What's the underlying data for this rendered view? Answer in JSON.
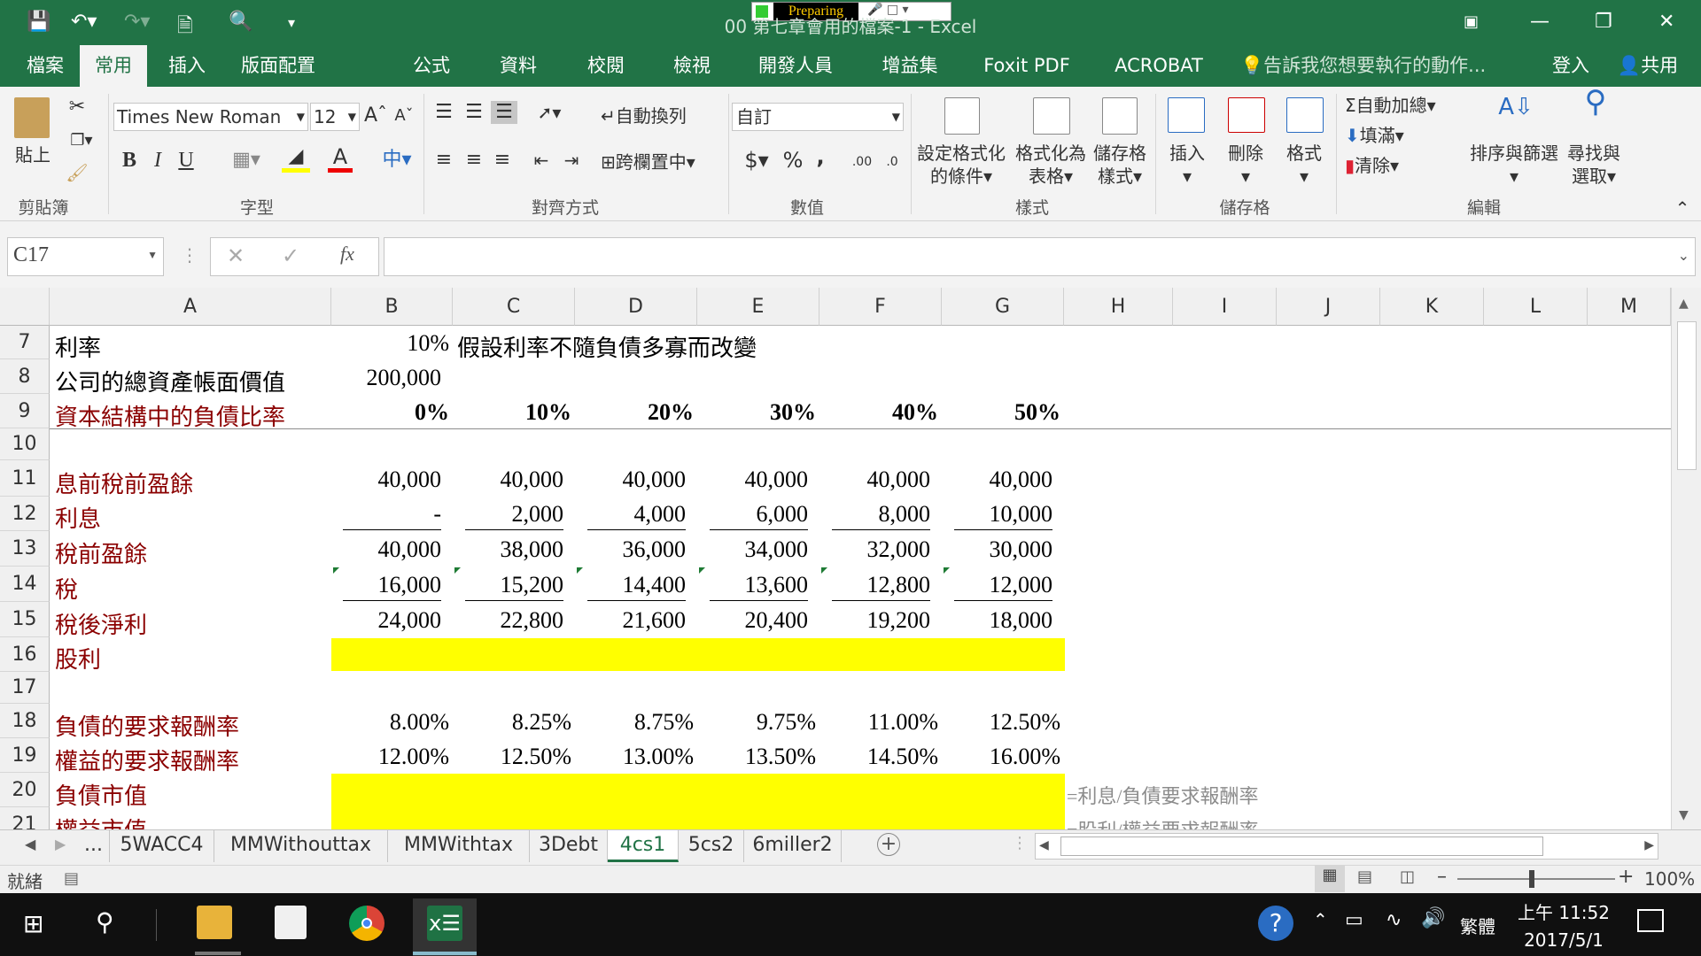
{
  "window": {
    "title": "00 第七章會用的檔案-1 - Excel",
    "preparing": "Preparing"
  },
  "ribbon_tabs": [
    "檔案",
    "常用",
    "插入",
    "版面配置",
    "公式",
    "資料",
    "校閱",
    "檢視",
    "開發人員",
    "增益集",
    "Foxit PDF",
    "ACROBAT"
  ],
  "tell_me": "告訴我您想要執行的動作...",
  "login": "登入",
  "share": "共用",
  "ribbon": {
    "paste": "貼上",
    "clipboard": "剪貼簿",
    "font_name": "Times New Roman",
    "font_size": "12",
    "font_group": "字型",
    "bold": "B",
    "italic": "I",
    "underline": "U",
    "font_color": "A",
    "cjk": "中",
    "wrap_text": "自動換列",
    "merge_center": "跨欄置中",
    "alignment_group": "對齊方式",
    "number_format": "自訂",
    "currency": "$",
    "percent": "%",
    "comma": ",",
    "inc_decimal": ".00",
    "dec_decimal": ".0",
    "number_group": "數值",
    "cond_format_1": "設定格式化",
    "cond_format_2": "的條件",
    "format_table_1": "格式化為",
    "format_table_2": "表格",
    "cell_styles_1": "儲存格",
    "cell_styles_2": "樣式",
    "styles_group": "樣式",
    "insert": "插入",
    "delete": "刪除",
    "format": "格式",
    "cells_group": "儲存格",
    "autosum": "自動加總",
    "fill": "填滿",
    "clear": "清除",
    "sort_filter": "排序與篩選",
    "find_select_1": "尋找與",
    "find_select_2": "選取",
    "editing_group": "編輯"
  },
  "formula_bar": {
    "name_box": "C17",
    "fx": "fx",
    "formula": ""
  },
  "columns": [
    "A",
    "B",
    "C",
    "D",
    "E",
    "F",
    "G",
    "H",
    "I",
    "J",
    "K",
    "L",
    "M"
  ],
  "rows": {
    "r7": {
      "num": "7",
      "label": "利率",
      "b": "10%",
      "note": "假設利率不隨負債多寡而改變"
    },
    "r8": {
      "num": "8",
      "label": "公司的總資產帳面價值",
      "b": "200,000"
    },
    "r9": {
      "num": "9",
      "label": "資本結構中的負債比率",
      "values": [
        "0%",
        "10%",
        "20%",
        "30%",
        "40%",
        "50%"
      ]
    },
    "r10": {
      "num": "10"
    },
    "r11": {
      "num": "11",
      "label": "息前稅前盈餘",
      "values": [
        "40,000",
        "40,000",
        "40,000",
        "40,000",
        "40,000",
        "40,000"
      ]
    },
    "r12": {
      "num": "12",
      "label": "利息",
      "values": [
        "-",
        "2,000",
        "4,000",
        "6,000",
        "8,000",
        "10,000"
      ]
    },
    "r13": {
      "num": "13",
      "label": "稅前盈餘",
      "values": [
        "40,000",
        "38,000",
        "36,000",
        "34,000",
        "32,000",
        "30,000"
      ]
    },
    "r14": {
      "num": "14",
      "label": "稅",
      "values": [
        "16,000",
        "15,200",
        "14,400",
        "13,600",
        "12,800",
        "12,000"
      ]
    },
    "r15": {
      "num": "15",
      "label": "稅後淨利",
      "values": [
        "24,000",
        "22,800",
        "21,600",
        "20,400",
        "19,200",
        "18,000"
      ]
    },
    "r16": {
      "num": "16",
      "label": "股利"
    },
    "r17": {
      "num": "17"
    },
    "r18": {
      "num": "18",
      "label": "負債的要求報酬率",
      "values": [
        "8.00%",
        "8.25%",
        "8.75%",
        "9.75%",
        "11.00%",
        "12.50%"
      ]
    },
    "r19": {
      "num": "19",
      "label": "權益的要求報酬率",
      "values": [
        "12.00%",
        "12.50%",
        "13.00%",
        "13.50%",
        "14.50%",
        "16.00%"
      ]
    },
    "r20": {
      "num": "20",
      "label": "負債市值",
      "note": "=利息/負債要求報酬率"
    },
    "r21": {
      "num": "21",
      "label": "權益市值",
      "note": "=股利/權益要求報酬率"
    }
  },
  "sheet_tabs": [
    "...",
    "5WACC4",
    "MMWithouttax",
    "MMWithtax",
    "3Debt",
    "4cs1",
    "5cs2",
    "6miller2"
  ],
  "active_sheet": "4cs1",
  "status": {
    "ready": "就緒",
    "zoom": "100%"
  },
  "taskbar": {
    "lang": "繁體",
    "time": "上午 11:52",
    "date": "2017/5/1"
  },
  "colors": {
    "excel_green": "#217346",
    "label_red": "#8b0000",
    "highlight": "#ffff00"
  }
}
